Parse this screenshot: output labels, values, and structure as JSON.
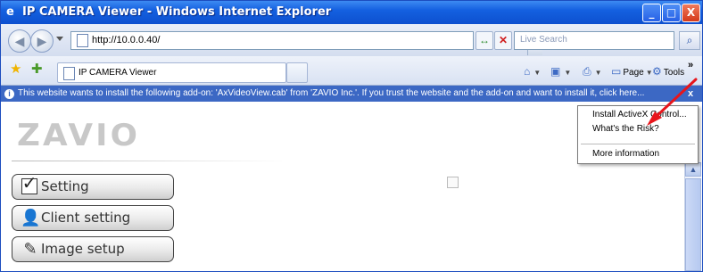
{
  "window": {
    "title": "IP CAMERA Viewer - Windows Internet Explorer",
    "minimize_glyph": "_",
    "maximize_glyph": "□",
    "close_glyph": "X"
  },
  "addressbar": {
    "url": "http://10.0.0.40/",
    "search_placeholder": "Live Search",
    "back_icon": "back-arrow-icon",
    "forward_icon": "forward-arrow-icon"
  },
  "tabs": {
    "active_title": "IP CAMERA Viewer"
  },
  "toolbar": {
    "page_label": "Page",
    "tools_label": "Tools",
    "more_glyph": "»"
  },
  "infobar": {
    "text": "This website wants to install the following add-on: 'AxVideoView.cab' from 'ZAVIO Inc.'. If you trust the website and the add-on and want to install it, click here...",
    "close_glyph": "x"
  },
  "popup_menu": {
    "items": [
      {
        "label": "Install ActiveX Control..."
      },
      {
        "label": "What's the Risk?"
      },
      {
        "label": "More information"
      }
    ]
  },
  "page": {
    "logo": "ZAVIO",
    "menu": [
      {
        "label": "Setting",
        "icon": "checkmark-icon"
      },
      {
        "label": "Client setting",
        "icon": "user-icon"
      },
      {
        "label": "Image setup",
        "icon": "image-setup-icon"
      }
    ]
  },
  "colors": {
    "titlebar": "#1460e0",
    "infobar": "#3c68c4",
    "arrow": "#e8151b"
  }
}
